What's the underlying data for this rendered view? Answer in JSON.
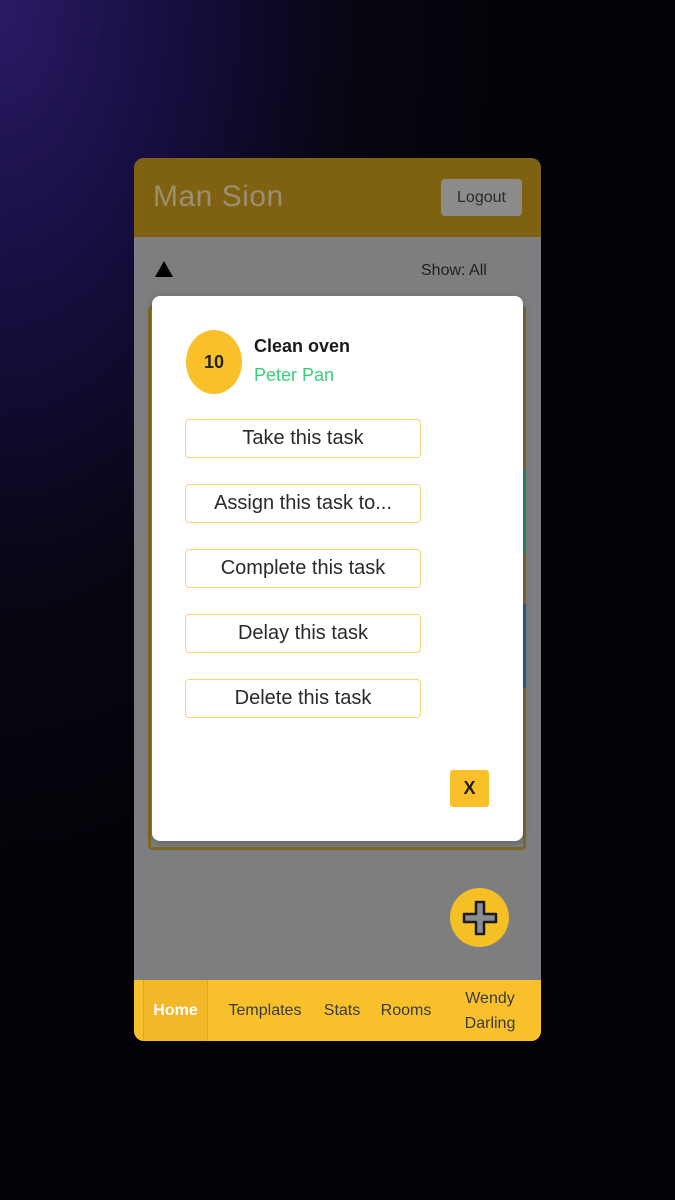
{
  "header": {
    "title": "Man Sion",
    "logout_label": "Logout"
  },
  "toolbar": {
    "sort_icon": "triangle-up-icon",
    "show_filter": "Show: All"
  },
  "fab": {
    "icon": "plus-icon"
  },
  "bottom_nav": {
    "items": [
      {
        "label": "Home",
        "active": true
      },
      {
        "label": "Templates",
        "active": false
      },
      {
        "label": "Stats",
        "active": false
      },
      {
        "label": "Rooms",
        "active": false
      },
      {
        "label": "Wendy Darling",
        "active": false
      }
    ]
  },
  "modal": {
    "score": "10",
    "task_name": "Clean oven",
    "assignee": "Peter Pan",
    "actions": [
      {
        "label": "Take this task"
      },
      {
        "label": "Assign this task to..."
      },
      {
        "label": "Complete this task"
      },
      {
        "label": "Delay this task"
      },
      {
        "label": "Delete this task"
      }
    ],
    "close_label": "X"
  },
  "colors": {
    "accent": "#f9c02a",
    "assignee": "#3dcc7a",
    "stripe_green": "#2a8a55",
    "stripe_blue": "#2b5f8f"
  }
}
